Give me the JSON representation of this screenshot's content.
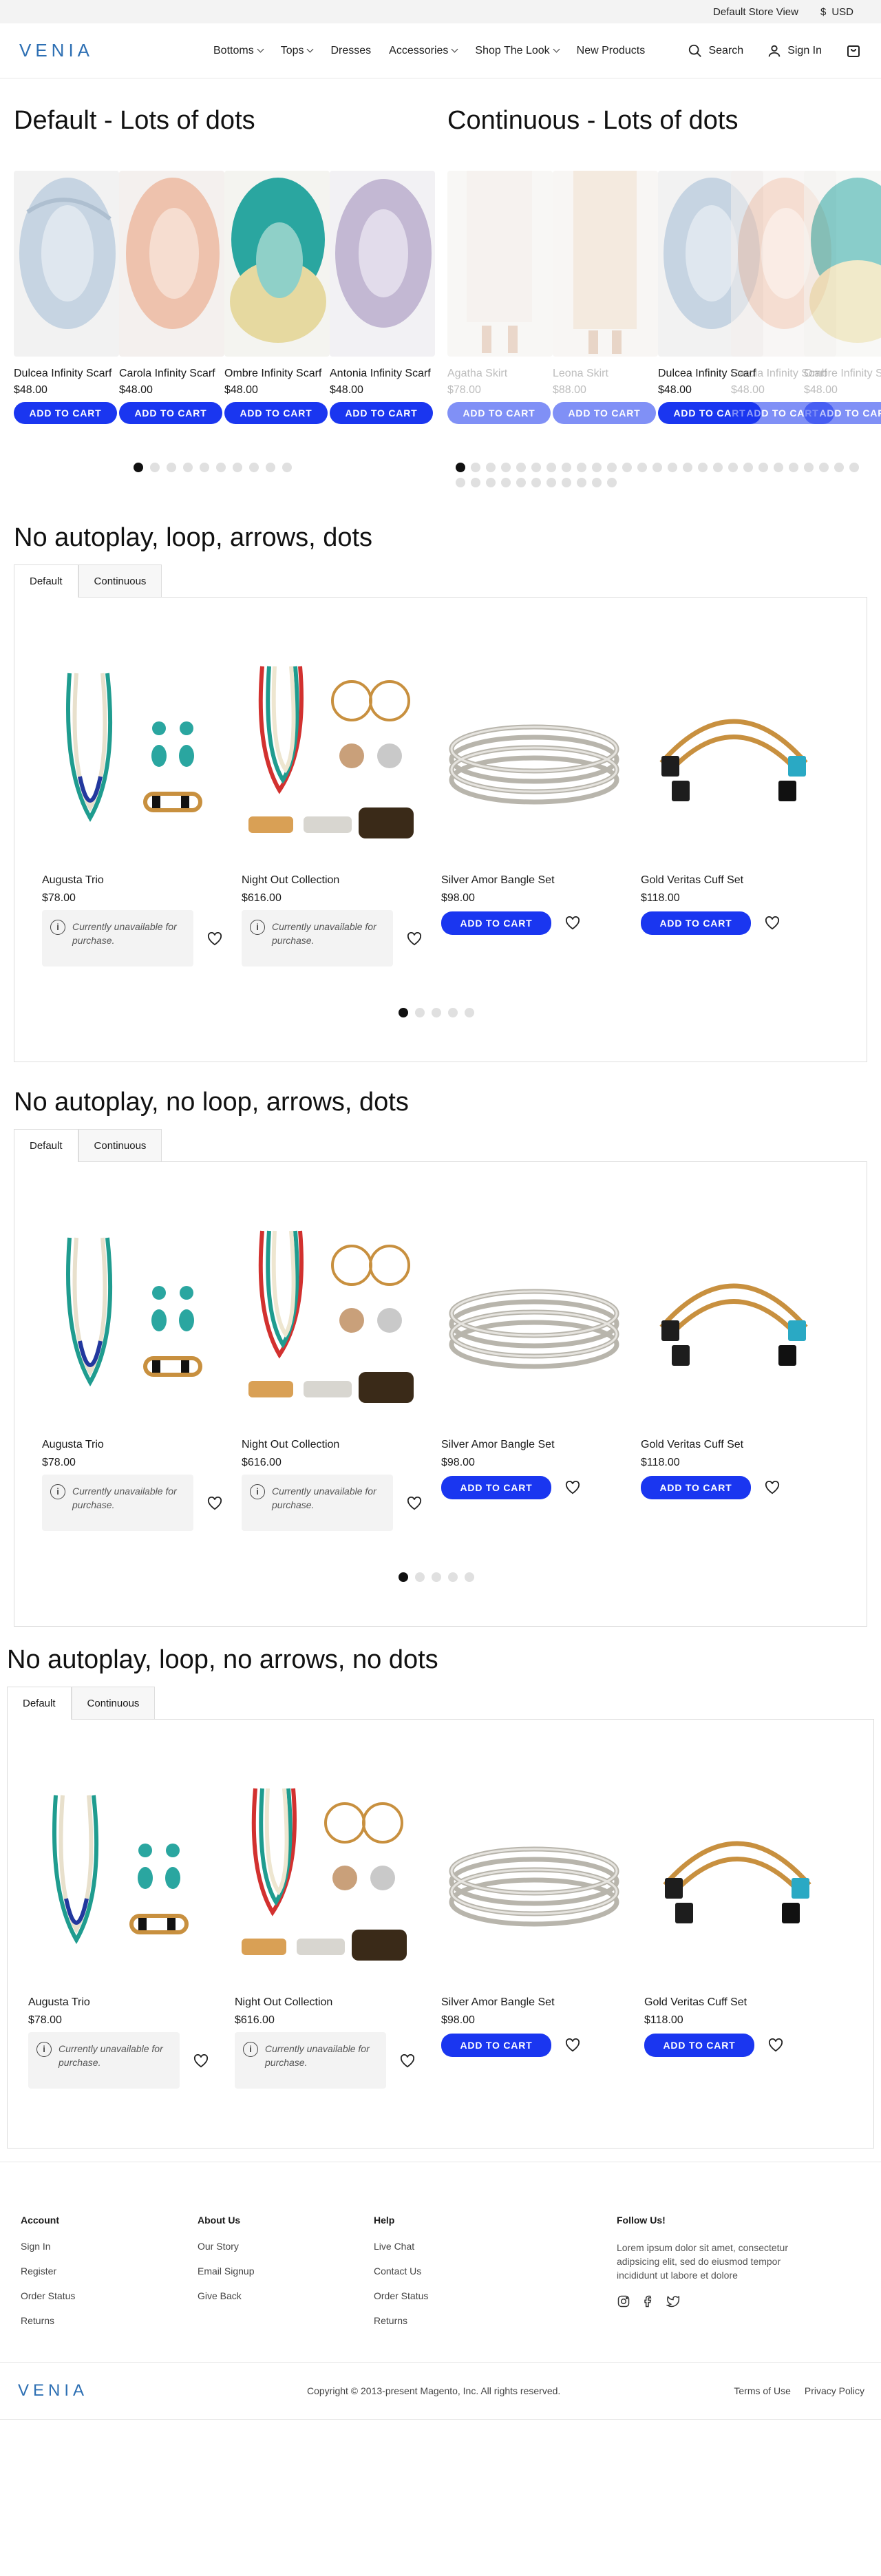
{
  "topbar": {
    "store_view": "Default Store View",
    "currency": "USD",
    "currency_symbol": "$"
  },
  "header": {
    "logo": "VENIA",
    "nav": [
      {
        "label": "Bottoms",
        "has_menu": true
      },
      {
        "label": "Tops",
        "has_menu": true
      },
      {
        "label": "Dresses",
        "has_menu": false
      },
      {
        "label": "Accessories",
        "has_menu": true
      },
      {
        "label": "Shop The Look",
        "has_menu": true
      },
      {
        "label": "New Products",
        "has_menu": false
      }
    ],
    "search_label": "Search",
    "signin_label": "Sign In"
  },
  "carousel_default": {
    "title": "Default - Lots of dots",
    "products": [
      {
        "name": "Dulcea Infinity Scarf",
        "price": "$48.00",
        "button": "ADD TO CART"
      },
      {
        "name": "Carola Infinity Scarf",
        "price": "$48.00",
        "button": "ADD TO CART"
      },
      {
        "name": "Ombre Infinity Scarf",
        "price": "$48.00",
        "button": "ADD TO CART"
      },
      {
        "name": "Antonia Infinity Scarf",
        "price": "$48.00",
        "button": "ADD TO CART"
      }
    ],
    "dots_count": 10,
    "active_dot": 0
  },
  "carousel_continuous": {
    "title": "Continuous - Lots of dots",
    "products": [
      {
        "name": "Agatha Skirt",
        "price": "$78.00",
        "button": "ADD TO CART"
      },
      {
        "name": "Leona Skirt",
        "price": "$88.00",
        "button": "ADD TO CART"
      },
      {
        "name": "Dulcea Infinity Scarf",
        "price": "$48.00",
        "button": "ADD TO CART"
      },
      {
        "name": "Carola Infinity Scarf",
        "price": "$48.00",
        "button": "ADD TO CART"
      },
      {
        "name": "Ombre Infinity Scarf",
        "price": "$48.00",
        "button": "ADD TO CART"
      }
    ],
    "dots_count": 38,
    "active_dot": 0
  },
  "sections": [
    {
      "title": "No autoplay, loop, arrows, dots",
      "tabs": [
        "Default",
        "Continuous"
      ],
      "dots_count": 5,
      "show_dots": true
    },
    {
      "title": "No autoplay, no loop, arrows, dots",
      "tabs": [
        "Default",
        "Continuous"
      ],
      "dots_count": 5,
      "show_dots": true
    },
    {
      "title": "No autoplay, loop, no arrows, no dots",
      "tabs": [
        "Default",
        "Continuous"
      ],
      "dots_count": 0,
      "show_dots": false
    }
  ],
  "jewelry": [
    {
      "name": "Augusta Trio",
      "price": "$78.00",
      "available": false,
      "unavailable_text": "Currently unavailable for purchase."
    },
    {
      "name": "Night Out Collection",
      "price": "$616.00",
      "available": false,
      "unavailable_text": "Currently unavailable for purchase."
    },
    {
      "name": "Silver Amor Bangle Set",
      "price": "$98.00",
      "available": true,
      "button": "ADD TO CART"
    },
    {
      "name": "Gold Veritas Cuff Set",
      "price": "$118.00",
      "available": true,
      "button": "ADD TO CART"
    }
  ],
  "footer": {
    "columns": [
      {
        "heading": "Account",
        "links": [
          "Sign In",
          "Register",
          "Order Status",
          "Returns"
        ]
      },
      {
        "heading": "About Us",
        "links": [
          "Our Story",
          "Email Signup",
          "Give Back"
        ]
      },
      {
        "heading": "Help",
        "links": [
          "Live Chat",
          "Contact Us",
          "Order Status",
          "Returns"
        ]
      }
    ],
    "follow_heading": "Follow Us!",
    "follow_text": "Lorem ipsum dolor sit amet, consectetur adipsicing elit, sed do eiusmod tempor incididunt ut labore et dolore",
    "logo": "VENIA",
    "copyright": "Copyright © 2013-present Magento, Inc. All rights reserved.",
    "legal_links": [
      "Terms of Use",
      "Privacy Policy"
    ]
  },
  "colors": {
    "accent": "#1a36f0",
    "dot_active": "#111111",
    "dot_inactive": "#e0e0e0"
  }
}
